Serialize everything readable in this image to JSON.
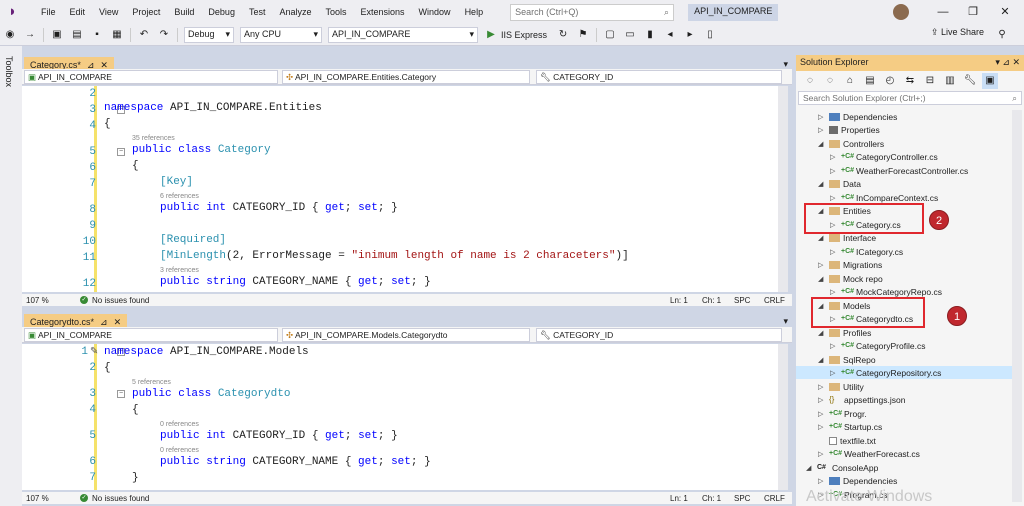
{
  "menubar": {
    "items": [
      "File",
      "Edit",
      "View",
      "Project",
      "Build",
      "Debug",
      "Test",
      "Analyze",
      "Tools",
      "Extensions",
      "Window",
      "Help"
    ],
    "search_placeholder": "Search (Ctrl+Q)",
    "solution_name": "API_IN_COMPARE"
  },
  "toolbar": {
    "config": "Debug",
    "platform": "Any CPU",
    "startup_project": "API_IN_COMPARE",
    "run_label": "IIS Express",
    "live_share": "Live Share"
  },
  "toolbox": {
    "label": "Toolbox"
  },
  "editor_top": {
    "tab_label": "Category.cs*",
    "nav_project": "API_IN_COMPARE",
    "nav_class": "API_IN_COMPARE.Entities.Category",
    "nav_member": "CATEGORY_ID",
    "zoom": "107 %",
    "issues": "No issues found",
    "ln": "Ln: 1",
    "ch": "Ch: 1",
    "spc": "SPC",
    "crlf": "CRLF",
    "line_numbers": [
      "2",
      "3",
      "4",
      "5",
      "6",
      "7",
      "8",
      "9",
      "10",
      "11",
      "12"
    ],
    "refs": [
      "35 references",
      "6 references",
      "3 references"
    ],
    "ns_kw": "namespace",
    "ns_name": " API_IN_COMPARE.Entities",
    "brace_open": "{",
    "public_kw": "public",
    "class_kw": " class ",
    "class_name": "Category",
    "attr_key": "[Key]",
    "attr_required": "[Required]",
    "minlength_name": "[MinLength",
    "minlength_args": "(2, ErrorMessage = ",
    "minlength_str": "\"inimum length of name is 2 characeters\"",
    "minlength_end": ")]",
    "int_kw": " int ",
    "string_kw": " string ",
    "prop_id": "CATEGORY_ID { ",
    "prop_name": "CATEGORY_NAME { ",
    "get_kw": "get",
    "set_kw": "set",
    "accessor_sep": "; ",
    "accessor_end": "; }"
  },
  "editor_bottom": {
    "tab_label": "Categorydto.cs*",
    "nav_project": "API_IN_COMPARE",
    "nav_class": "API_IN_COMPARE.Models.Categorydto",
    "nav_member": "CATEGORY_ID",
    "zoom": "107 %",
    "issues": "No issues found",
    "ln": "Ln: 1",
    "ch": "Ch: 1",
    "spc": "SPC",
    "crlf": "CRLF",
    "line_numbers": [
      "1",
      "2",
      "3",
      "4",
      "5",
      "6",
      "7"
    ],
    "refs": [
      "5 references",
      "0 references",
      "0 references"
    ],
    "ns_name": " API_IN_COMPARE.Models",
    "class_name": "Categorydto",
    "brace_close": "}"
  },
  "solution_explorer": {
    "title": "Solution Explorer",
    "search_placeholder": "Search Solution Explorer (Ctrl+;)",
    "nodes": [
      "Dependencies",
      "Properties",
      "Controllers",
      "CategoryController.cs",
      "WeatherForecastController.cs",
      "Data",
      "InCompareContext.cs",
      "Entities",
      "Category.cs",
      "Interface",
      "ICategory.cs",
      "Migrations",
      "Mock repo",
      "MockCategoryRepo.cs",
      "Models",
      "Categorydto.cs",
      "Profiles",
      "CategoryProfile.cs",
      "SqlRepo",
      "CategoryRepository.cs",
      "Utility",
      "appsettings.json",
      "Progr.",
      "Startup.cs",
      "textfile.txt",
      "WeatherForecast.cs",
      "ConsoleApp",
      "Dependencies",
      "Program.cs"
    ],
    "annotation_1": "1",
    "annotation_2": "2"
  },
  "watermark": "Activate Windows",
  "colors": {
    "accent": "#68217a",
    "tab_active": "#f5cc84",
    "annotation_red": "#c0282e"
  }
}
